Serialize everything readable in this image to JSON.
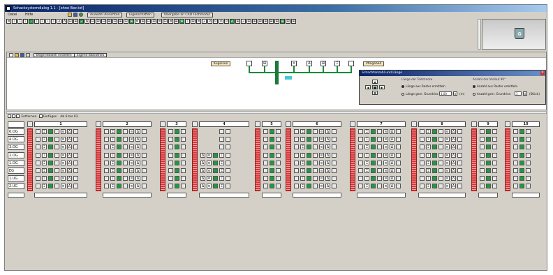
{
  "window": {
    "title": "Schacksystemdialog 1.1 - [ohne Bez.txt]"
  },
  "menu": [
    "Datei",
    "Hilfe"
  ],
  "toolbar": {
    "btn1": "Auswahl Ansichten",
    "btn2": "Eigenschaften",
    "btn3": "Übergabe an CAD Fachmodul"
  },
  "symbols": [
    "≡",
    "⊥",
    "⌶",
    "⌶",
    "⊥",
    "⌶",
    "⌶",
    "⊥",
    "⌶",
    "⊿",
    "Δ",
    "⊟",
    "⊞",
    "⊿",
    "Δ",
    "⊟",
    "⊞",
    "⊟",
    "⊞",
    "⊟",
    "⊞",
    "⊟",
    "⊞",
    "≡",
    "⊞",
    "⊟",
    "⊞",
    "≡",
    "⊟",
    "≡",
    "⊞",
    "Ψ",
    "⌶",
    "⊞",
    "≡",
    "⊿",
    "⊙",
    "⊙",
    "⊙",
    "⊙",
    "∆",
    "⊞",
    "⊿",
    "⊞",
    "⊞",
    "⊞",
    "⊞",
    "⊞",
    "⊞",
    "⊞",
    "⊞",
    "⊞"
  ],
  "sub": {
    "btn1": "Begeriebstell erstellen",
    "btn2": "Eigene Bibliothek",
    "tag_left": "Kugelsen",
    "tag_right": "Pflegebad"
  },
  "panel": {
    "title": "Schachtanzahl und Länge",
    "group_left": "Länge der Teilstrecke",
    "group_right": "Anzahl der Vorlauf 90°",
    "opt1": "Länge aus Raster ermitteln",
    "opt2": "Länge gem. Grundriss:",
    "opt2_value": "1,00",
    "opt2_unit": "(m)",
    "opt3": "Anzahl aus Raster ermitteln",
    "opt4": "Anzahl gem. Grundriss:",
    "opt4_value": "1",
    "opt4_unit": "(Stück)"
  },
  "gridtool": {
    "delete": "Entfernen",
    "insert": "Einfügen",
    "from": "Ab",
    "floor": "6 bis",
    "floor_num": "03"
  },
  "floors": [
    "6.OG",
    "4.OG",
    "3.OG",
    "2.OG",
    "1.OG",
    "EG",
    "1.UG",
    "2.UG"
  ],
  "columns": [
    "1",
    "2",
    "3",
    "4",
    "5",
    "6",
    "7",
    "8",
    "9",
    "10"
  ],
  "colors": {
    "green": "#1f9a3e",
    "red": "#d6383a",
    "title": "#0a246a"
  }
}
